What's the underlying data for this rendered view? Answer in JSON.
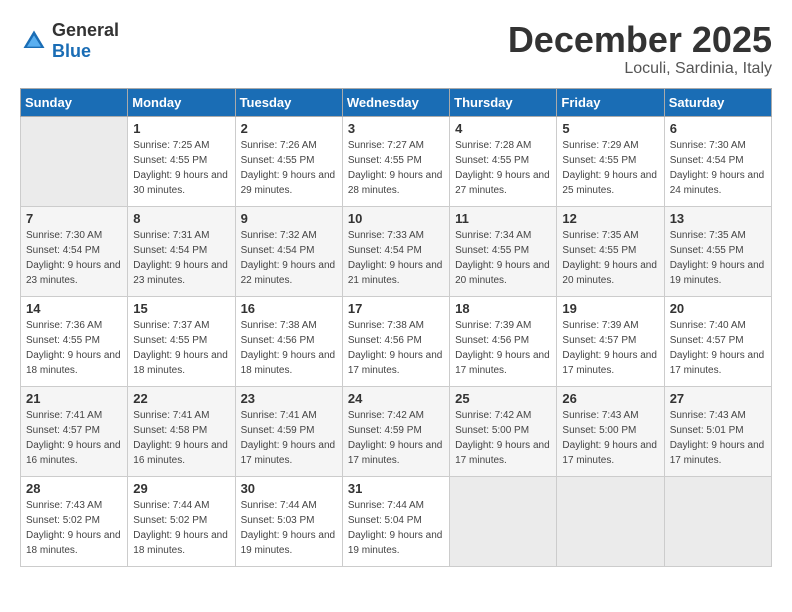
{
  "header": {
    "logo_general": "General",
    "logo_blue": "Blue",
    "month": "December 2025",
    "location": "Loculi, Sardinia, Italy"
  },
  "weekdays": [
    "Sunday",
    "Monday",
    "Tuesday",
    "Wednesday",
    "Thursday",
    "Friday",
    "Saturday"
  ],
  "weeks": [
    [
      {
        "day": "",
        "empty": true
      },
      {
        "day": "1",
        "sunrise": "Sunrise: 7:25 AM",
        "sunset": "Sunset: 4:55 PM",
        "daylight": "Daylight: 9 hours and 30 minutes."
      },
      {
        "day": "2",
        "sunrise": "Sunrise: 7:26 AM",
        "sunset": "Sunset: 4:55 PM",
        "daylight": "Daylight: 9 hours and 29 minutes."
      },
      {
        "day": "3",
        "sunrise": "Sunrise: 7:27 AM",
        "sunset": "Sunset: 4:55 PM",
        "daylight": "Daylight: 9 hours and 28 minutes."
      },
      {
        "day": "4",
        "sunrise": "Sunrise: 7:28 AM",
        "sunset": "Sunset: 4:55 PM",
        "daylight": "Daylight: 9 hours and 27 minutes."
      },
      {
        "day": "5",
        "sunrise": "Sunrise: 7:29 AM",
        "sunset": "Sunset: 4:55 PM",
        "daylight": "Daylight: 9 hours and 25 minutes."
      },
      {
        "day": "6",
        "sunrise": "Sunrise: 7:30 AM",
        "sunset": "Sunset: 4:54 PM",
        "daylight": "Daylight: 9 hours and 24 minutes."
      }
    ],
    [
      {
        "day": "7",
        "sunrise": "Sunrise: 7:30 AM",
        "sunset": "Sunset: 4:54 PM",
        "daylight": "Daylight: 9 hours and 23 minutes."
      },
      {
        "day": "8",
        "sunrise": "Sunrise: 7:31 AM",
        "sunset": "Sunset: 4:54 PM",
        "daylight": "Daylight: 9 hours and 23 minutes."
      },
      {
        "day": "9",
        "sunrise": "Sunrise: 7:32 AM",
        "sunset": "Sunset: 4:54 PM",
        "daylight": "Daylight: 9 hours and 22 minutes."
      },
      {
        "day": "10",
        "sunrise": "Sunrise: 7:33 AM",
        "sunset": "Sunset: 4:54 PM",
        "daylight": "Daylight: 9 hours and 21 minutes."
      },
      {
        "day": "11",
        "sunrise": "Sunrise: 7:34 AM",
        "sunset": "Sunset: 4:55 PM",
        "daylight": "Daylight: 9 hours and 20 minutes."
      },
      {
        "day": "12",
        "sunrise": "Sunrise: 7:35 AM",
        "sunset": "Sunset: 4:55 PM",
        "daylight": "Daylight: 9 hours and 20 minutes."
      },
      {
        "day": "13",
        "sunrise": "Sunrise: 7:35 AM",
        "sunset": "Sunset: 4:55 PM",
        "daylight": "Daylight: 9 hours and 19 minutes."
      }
    ],
    [
      {
        "day": "14",
        "sunrise": "Sunrise: 7:36 AM",
        "sunset": "Sunset: 4:55 PM",
        "daylight": "Daylight: 9 hours and 18 minutes."
      },
      {
        "day": "15",
        "sunrise": "Sunrise: 7:37 AM",
        "sunset": "Sunset: 4:55 PM",
        "daylight": "Daylight: 9 hours and 18 minutes."
      },
      {
        "day": "16",
        "sunrise": "Sunrise: 7:38 AM",
        "sunset": "Sunset: 4:56 PM",
        "daylight": "Daylight: 9 hours and 18 minutes."
      },
      {
        "day": "17",
        "sunrise": "Sunrise: 7:38 AM",
        "sunset": "Sunset: 4:56 PM",
        "daylight": "Daylight: 9 hours and 17 minutes."
      },
      {
        "day": "18",
        "sunrise": "Sunrise: 7:39 AM",
        "sunset": "Sunset: 4:56 PM",
        "daylight": "Daylight: 9 hours and 17 minutes."
      },
      {
        "day": "19",
        "sunrise": "Sunrise: 7:39 AM",
        "sunset": "Sunset: 4:57 PM",
        "daylight": "Daylight: 9 hours and 17 minutes."
      },
      {
        "day": "20",
        "sunrise": "Sunrise: 7:40 AM",
        "sunset": "Sunset: 4:57 PM",
        "daylight": "Daylight: 9 hours and 17 minutes."
      }
    ],
    [
      {
        "day": "21",
        "sunrise": "Sunrise: 7:41 AM",
        "sunset": "Sunset: 4:57 PM",
        "daylight": "Daylight: 9 hours and 16 minutes."
      },
      {
        "day": "22",
        "sunrise": "Sunrise: 7:41 AM",
        "sunset": "Sunset: 4:58 PM",
        "daylight": "Daylight: 9 hours and 16 minutes."
      },
      {
        "day": "23",
        "sunrise": "Sunrise: 7:41 AM",
        "sunset": "Sunset: 4:59 PM",
        "daylight": "Daylight: 9 hours and 17 minutes."
      },
      {
        "day": "24",
        "sunrise": "Sunrise: 7:42 AM",
        "sunset": "Sunset: 4:59 PM",
        "daylight": "Daylight: 9 hours and 17 minutes."
      },
      {
        "day": "25",
        "sunrise": "Sunrise: 7:42 AM",
        "sunset": "Sunset: 5:00 PM",
        "daylight": "Daylight: 9 hours and 17 minutes."
      },
      {
        "day": "26",
        "sunrise": "Sunrise: 7:43 AM",
        "sunset": "Sunset: 5:00 PM",
        "daylight": "Daylight: 9 hours and 17 minutes."
      },
      {
        "day": "27",
        "sunrise": "Sunrise: 7:43 AM",
        "sunset": "Sunset: 5:01 PM",
        "daylight": "Daylight: 9 hours and 17 minutes."
      }
    ],
    [
      {
        "day": "28",
        "sunrise": "Sunrise: 7:43 AM",
        "sunset": "Sunset: 5:02 PM",
        "daylight": "Daylight: 9 hours and 18 minutes."
      },
      {
        "day": "29",
        "sunrise": "Sunrise: 7:44 AM",
        "sunset": "Sunset: 5:02 PM",
        "daylight": "Daylight: 9 hours and 18 minutes."
      },
      {
        "day": "30",
        "sunrise": "Sunrise: 7:44 AM",
        "sunset": "Sunset: 5:03 PM",
        "daylight": "Daylight: 9 hours and 19 minutes."
      },
      {
        "day": "31",
        "sunrise": "Sunrise: 7:44 AM",
        "sunset": "Sunset: 5:04 PM",
        "daylight": "Daylight: 9 hours and 19 minutes."
      },
      {
        "day": "",
        "empty": true
      },
      {
        "day": "",
        "empty": true
      },
      {
        "day": "",
        "empty": true
      }
    ]
  ]
}
